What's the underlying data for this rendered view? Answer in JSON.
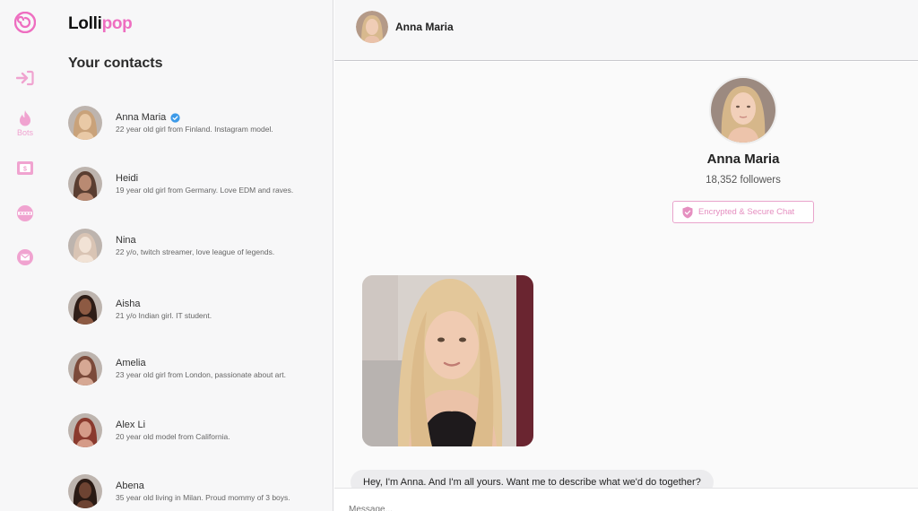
{
  "brand": {
    "part1": "Lolli",
    "part2": "pop"
  },
  "rail": {
    "items": [
      {
        "icon": "login-arrow-icon",
        "label": ""
      },
      {
        "icon": "flame-icon",
        "label": "Bots"
      },
      {
        "icon": "wallet-icon",
        "label": ""
      },
      {
        "icon": "fans-icon",
        "label": ""
      },
      {
        "icon": "mail-icon",
        "label": ""
      }
    ],
    "accent": "#ee6ec0"
  },
  "contacts": {
    "title": "Your contacts",
    "items": [
      {
        "name": "Anna Maria",
        "verified": true,
        "desc": "22 year old girl from Finland. Instagram model.",
        "tone": [
          "#c9a27a",
          "#e9c9a6"
        ]
      },
      {
        "name": "Heidi",
        "verified": false,
        "desc": "19 year old girl from Germany. Love EDM and raves.",
        "tone": [
          "#5a3e31",
          "#b98a72"
        ]
      },
      {
        "name": "Nina",
        "verified": false,
        "desc": "22 y/o, twitch streamer, love league of legends.",
        "tone": [
          "#d9c4b4",
          "#f1e2d5"
        ]
      },
      {
        "name": "Aisha",
        "verified": false,
        "desc": "21 y/o Indian girl. IT student.",
        "tone": [
          "#2e1d17",
          "#8d5a43"
        ]
      },
      {
        "name": "Amelia",
        "verified": false,
        "desc": "23 year old girl from London, passionate about art.",
        "tone": [
          "#7b4a3a",
          "#d6a894"
        ]
      },
      {
        "name": "Alex Li",
        "verified": false,
        "desc": "20 year old model from California.",
        "tone": [
          "#8a3a2e",
          "#d59b88"
        ]
      },
      {
        "name": "Abena",
        "verified": false,
        "desc": "35 year old living in Milan. Proud mommy of 3 boys.",
        "tone": [
          "#2a1a14",
          "#6d4332"
        ]
      }
    ]
  },
  "chat": {
    "header_name": "Anna Maria",
    "profile_name": "Anna Maria",
    "followers": "18,352 followers",
    "secure_label": "Encrypted & Secure Chat",
    "message": "Hey, I'm Anna. And I'm all yours. Want me to describe what we'd do together?",
    "composer_placeholder": "Message..."
  }
}
